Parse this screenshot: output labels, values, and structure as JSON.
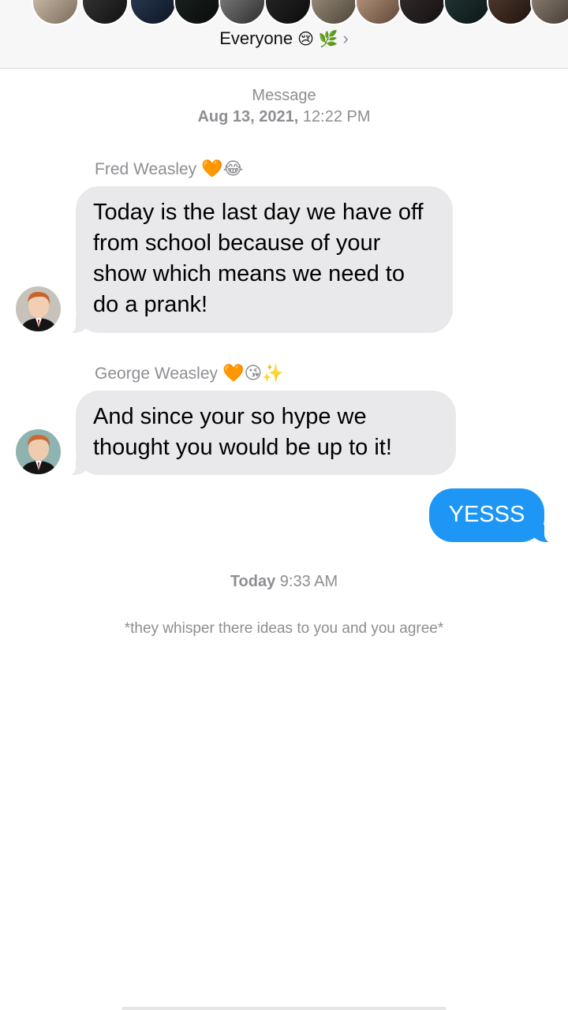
{
  "header": {
    "title": "Everyone",
    "title_emoji": "😢 🌿",
    "chevron": "›"
  },
  "stamps": {
    "first_label": "Message",
    "first_date": "Aug 13, 2021,",
    "first_time": "12:22 PM",
    "second_day": "Today",
    "second_time": "9:33 AM"
  },
  "messages": [
    {
      "sender": "Fred Weasley",
      "sender_emoji": "🧡😂",
      "text": "Today is the last day we have off from school because of your show which means we need to do a prank!",
      "avatar_icon": "fred-avatar"
    },
    {
      "sender": "George Weasley",
      "sender_emoji": "🧡😘✨",
      "text": "And since your so hype we thought you would be up to it!",
      "avatar_icon": "george-avatar"
    },
    {
      "sender": "",
      "text": "YESSS",
      "outgoing": true
    }
  ],
  "narration": "*they whisper there ideas to you and you agree*",
  "colors": {
    "incoming_bubble": "#e9e9eb",
    "outgoing_bubble": "#1e96f5",
    "meta_text": "#8e8e93"
  }
}
